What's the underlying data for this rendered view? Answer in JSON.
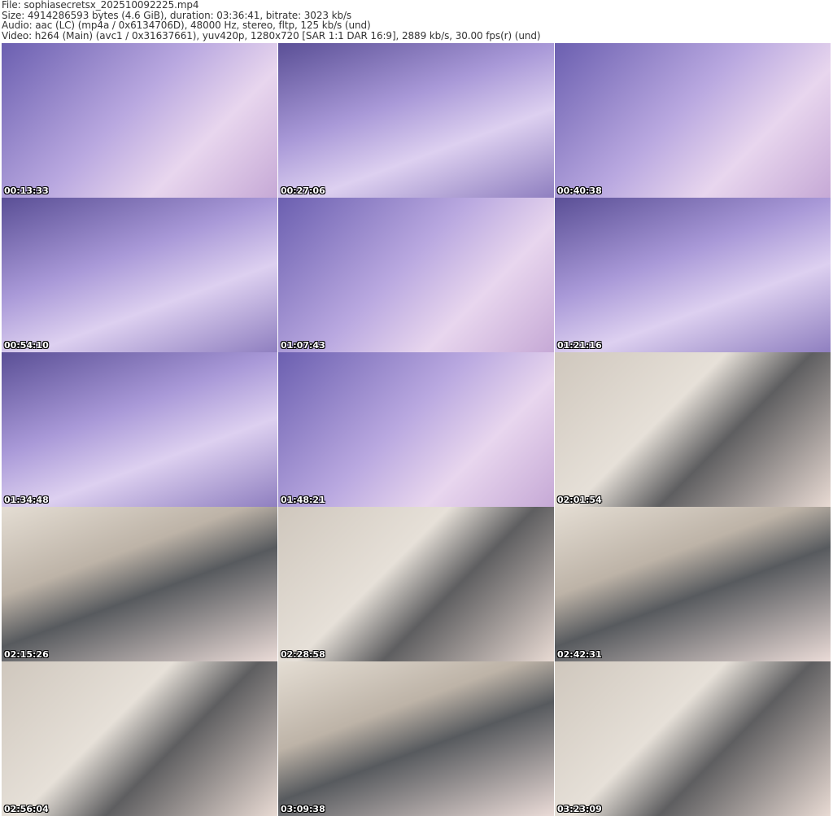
{
  "header": {
    "file": "File: sophiasecretsx_202510092225.mp4",
    "size": "Size: 4914286593 bytes (4.6 GiB), duration: 03:36:41, bitrate: 3023 kb/s",
    "audio": "Audio: aac (LC) (mp4a / 0x6134706D), 48000 Hz, stereo, fltp, 125 kb/s (und)",
    "video": "Video: h264 (Main) (avc1 / 0x31637661), yuv420p, 1280x720 [SAR 1:1 DAR 16:9], 2889 kb/s, 30.00 fps(r) (und)"
  },
  "thumbnails": [
    {
      "timestamp": "00:13:33"
    },
    {
      "timestamp": "00:27:06"
    },
    {
      "timestamp": "00:40:38"
    },
    {
      "timestamp": "00:54:10"
    },
    {
      "timestamp": "01:07:43"
    },
    {
      "timestamp": "01:21:16"
    },
    {
      "timestamp": "01:34:48"
    },
    {
      "timestamp": "01:48:21"
    },
    {
      "timestamp": "02:01:54"
    },
    {
      "timestamp": "02:15:26"
    },
    {
      "timestamp": "02:28:58"
    },
    {
      "timestamp": "02:42:31"
    },
    {
      "timestamp": "02:56:04"
    },
    {
      "timestamp": "03:09:38"
    },
    {
      "timestamp": "03:23:09"
    }
  ]
}
